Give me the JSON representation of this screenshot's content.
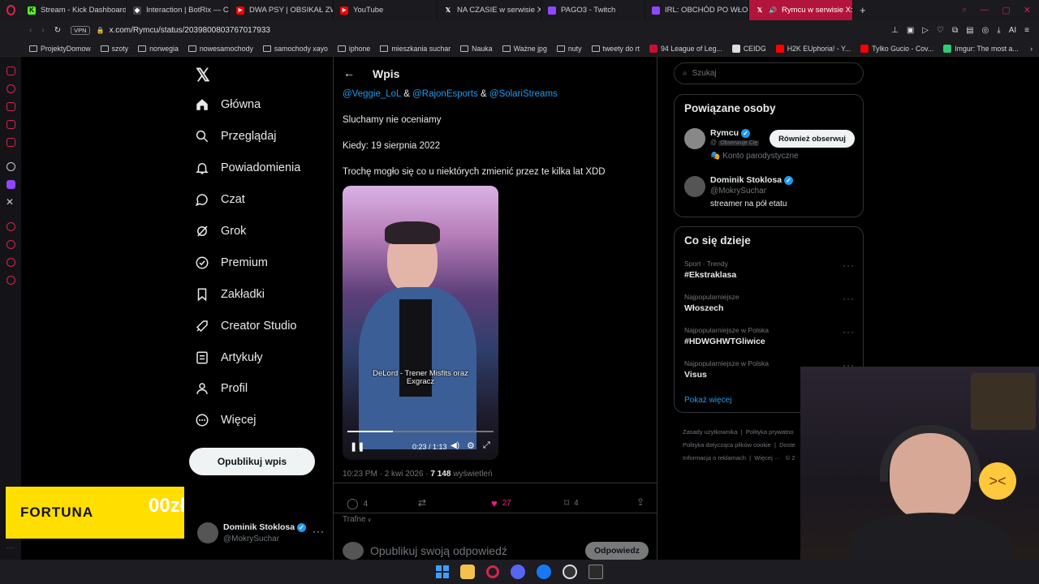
{
  "browser": {
    "tabs": [
      {
        "label": "Stream - Kick Dashboard",
        "icon": "kick-icon",
        "color": "#53fc18"
      },
      {
        "label": "Interaction | BotRix — Clo",
        "icon": "botrix-icon",
        "color": "#ffffff"
      },
      {
        "label": "DWA PSY | OBSIKAŁ ZWI",
        "icon": "youtube-icon",
        "color": "#ff0000"
      },
      {
        "label": "YouTube",
        "icon": "youtube-icon",
        "color": "#ff0000"
      },
      {
        "label": "NA CZASIE w serwisie X:",
        "icon": "x-icon",
        "color": "#ffffff"
      },
      {
        "label": "PAGO3 - Twitch",
        "icon": "twitch-icon",
        "color": "#9146ff"
      },
      {
        "label": "IRL: OBCHÓD PO WŁOSK",
        "icon": "twitch-icon",
        "color": "#9146ff"
      },
      {
        "label": "Rymcu w serwisie X: „",
        "icon": "x-icon",
        "color": "#ffffff"
      }
    ],
    "url": "x.com/Rymcu/status/2039800803767017933",
    "vpn_label": "VPN",
    "ai_label": "AI",
    "bookmarks": [
      {
        "label": "ProjektyDomow",
        "icon": "folder-icon"
      },
      {
        "label": "szoty",
        "icon": "folder-icon"
      },
      {
        "label": "norwegia",
        "icon": "folder-icon"
      },
      {
        "label": "nowesamochody",
        "icon": "folder-icon"
      },
      {
        "label": "samochody xayo",
        "icon": "folder-icon"
      },
      {
        "label": "iphone",
        "icon": "folder-icon"
      },
      {
        "label": "mieszkania suchar",
        "icon": "folder-icon"
      },
      {
        "label": "Nauka",
        "icon": "folder-icon"
      },
      {
        "label": "Ważne jpg",
        "icon": "folder-icon"
      },
      {
        "label": "nuty",
        "icon": "folder-icon"
      },
      {
        "label": "tweety do rt",
        "icon": "folder-icon"
      },
      {
        "label": "94 League of Leg...",
        "icon": "lol-icon"
      },
      {
        "label": "CEIDG",
        "icon": "ceidg-icon"
      },
      {
        "label": "H2K EUphoria! - Y...",
        "icon": "youtube-icon"
      },
      {
        "label": "Tylko Gucio - Cov...",
        "icon": "youtube-icon"
      },
      {
        "label": "Imgur: The most a...",
        "icon": "imgur-icon"
      }
    ]
  },
  "nav": {
    "items": [
      {
        "label": "Główna",
        "icon": "home-icon"
      },
      {
        "label": "Przeglądaj",
        "icon": "search-icon"
      },
      {
        "label": "Powiadomienia",
        "icon": "bell-icon"
      },
      {
        "label": "Czat",
        "icon": "chat-icon"
      },
      {
        "label": "Grok",
        "icon": "grok-icon"
      },
      {
        "label": "Premium",
        "icon": "premium-icon"
      },
      {
        "label": "Zakładki",
        "icon": "bookmark-icon"
      },
      {
        "label": "Creator Studio",
        "icon": "rocket-icon"
      },
      {
        "label": "Artykuły",
        "icon": "article-icon"
      },
      {
        "label": "Profil",
        "icon": "person-icon"
      },
      {
        "label": "Więcej",
        "icon": "more-icon"
      }
    ],
    "post_button": "Opublikuj wpis",
    "account": {
      "name": "Dominik Stoklosa",
      "handle": "@MokrySuchar"
    }
  },
  "post": {
    "header": "Wpis",
    "mentions": [
      "@Veggie_LoL",
      "@RajonEsports",
      "@SolariStreams"
    ],
    "amp": "&",
    "line1": "Sluchamy nie oceniamy",
    "line2": "Kiedy: 19 sierpnia 2022",
    "line3": "Trochę mogło się co u niektórych zmienić przez te kilka lat XDD",
    "video": {
      "caption_line1": "DeLord - Trener Misfits oraz",
      "caption_line2": "Exgracz",
      "time": "0:23 / 1:13",
      "progress": 0.31
    },
    "meta_time": "10:23 PM · 2 kwi 2026 · ",
    "views": "7 148",
    "views_label": "wyświetleń",
    "actions": {
      "replies": "4",
      "retweets": "",
      "likes": "27",
      "bookmarks": "4"
    },
    "sort": "Trafne",
    "reply_placeholder": "Opublikuj swoją odpowiedź",
    "reply_button": "Odpowiedz"
  },
  "sidebar": {
    "search_placeholder": "Szukaj",
    "related_title": "Powiązane osoby",
    "related": [
      {
        "name": "Rymcu",
        "handle": "@",
        "badge": "Obserwuje Cię",
        "bio": "🎭 Konto parodystyczne",
        "button": "Również obserwuj"
      },
      {
        "name": "Dominik Stoklosa",
        "handle": "@MokrySuchar",
        "bio": "streamer na pół etatu"
      }
    ],
    "trends_title": "Co się dzieje",
    "trends": [
      {
        "context": "Sport · Trendy",
        "name": "#Ekstraklasa"
      },
      {
        "context": "Najpopularniejsze",
        "name": "Włoszech"
      },
      {
        "context": "Najpopularniejsze w Polska",
        "name": "#HDWGHWTGliwice"
      },
      {
        "context": "Najpopularniejsze w Polska",
        "name": "Visus"
      }
    ],
    "show_more": "Pokaż więcej",
    "footer": [
      "Zasady użytkownika",
      "Polityka prywatno",
      "Polityka dotycząca plików cookie",
      "Doste",
      "Informacja o reklamach",
      "Więcej ···",
      "© 2"
    ]
  },
  "overlay": {
    "ad_text": "FORTUNA",
    "ad_partial": "00zł"
  }
}
